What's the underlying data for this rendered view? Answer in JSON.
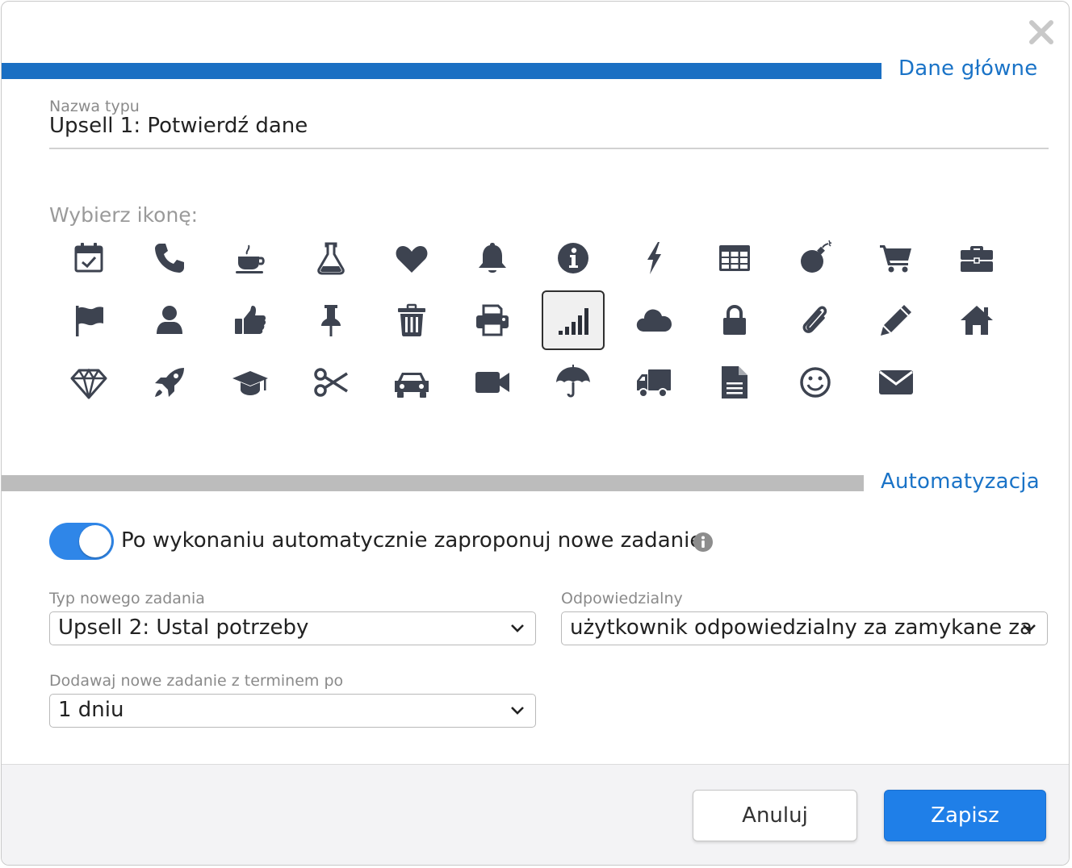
{
  "colors": {
    "accent": "#1a73c7",
    "main_bar": "#1a6fc3",
    "auto_bar": "#bcbcbc",
    "icon": "#3d4350",
    "toggle": "#2f86e8",
    "save": "#1f7fe8"
  },
  "sections": {
    "main_title": "Dane główne",
    "automation_title": "Automatyzacja"
  },
  "name_field": {
    "label": "Nazwa typu",
    "value": "Upsell 1: Potwierdź dane"
  },
  "icon_picker": {
    "label": "Wybierz ikonę:",
    "selected": "signal-icon",
    "rows": [
      [
        "calendar-check-icon",
        "phone-icon",
        "coffee-icon",
        "flask-icon",
        "heart-icon",
        "bell-icon",
        "info-circle-icon",
        "bolt-icon",
        "table-icon",
        "bomb-icon",
        "shopping-cart-icon",
        "briefcase-icon"
      ],
      [
        "flag-icon",
        "user-icon",
        "thumbs-up-icon",
        "thumbtack-icon",
        "trash-icon",
        "print-icon",
        "signal-icon",
        "cloud-icon",
        "lock-icon",
        "paperclip-icon",
        "pencil-icon",
        "home-icon"
      ],
      [
        "diamond-icon",
        "rocket-icon",
        "graduation-cap-icon",
        "scissors-icon",
        "car-icon",
        "video-camera-icon",
        "umbrella-icon",
        "truck-icon",
        "file-text-icon",
        "smile-icon",
        "envelope-icon"
      ]
    ]
  },
  "automation": {
    "toggle_label": "Po wykonaniu automatycznie zaproponuj nowe zadanie",
    "toggle_on": true,
    "new_task_type": {
      "label": "Typ nowego zadania",
      "value": "Upsell 2: Ustal potrzeby"
    },
    "responsible": {
      "label": "Odpowiedzialny",
      "value": "użytkownik odpowiedzialny za zamykane za"
    },
    "due_after": {
      "label": "Dodawaj nowe zadanie z terminem po",
      "value": "1 dniu"
    }
  },
  "footer": {
    "cancel_label": "Anuluj",
    "save_label": "Zapisz"
  }
}
